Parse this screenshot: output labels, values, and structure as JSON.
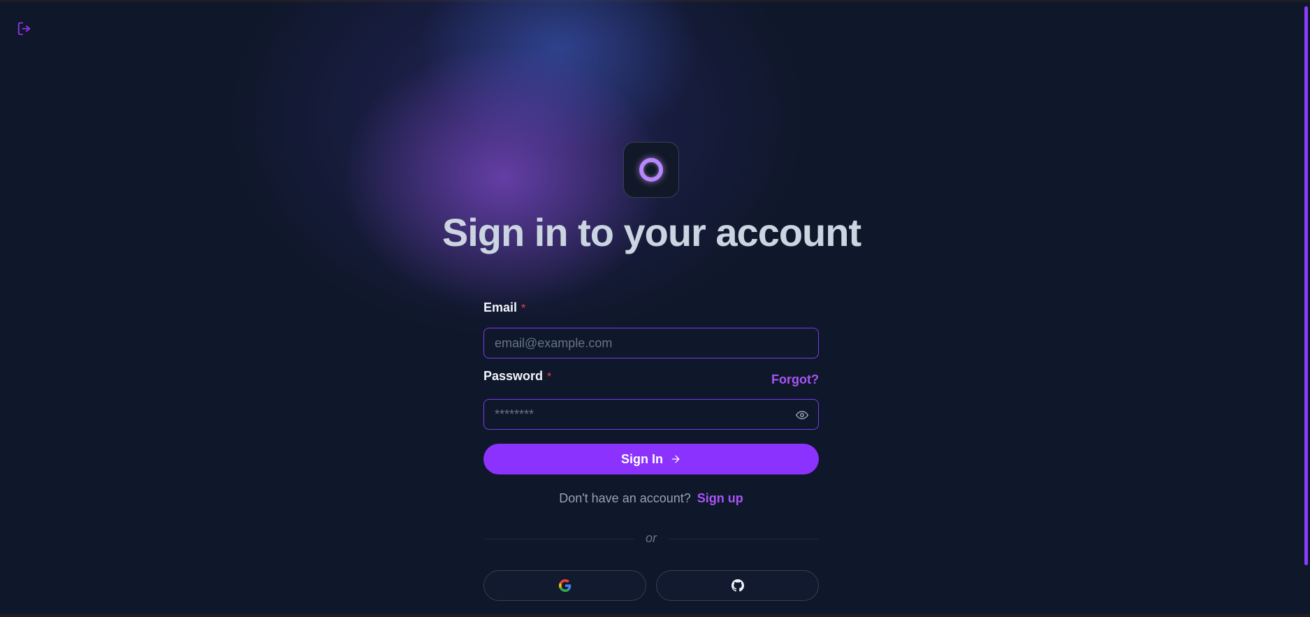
{
  "page": {
    "title": "Sign in to your account"
  },
  "form": {
    "email_label": "Email",
    "email_required_mark": "*",
    "email_placeholder": "email@example.com",
    "password_label": "Password",
    "password_required_mark": "*",
    "password_placeholder": "********",
    "forgot_label": "Forgot?",
    "signin_label": "Sign In",
    "signup_prompt": "Don't have an account?",
    "signup_link": "Sign up",
    "divider_label": "or"
  },
  "icons": {
    "exit": "log-out-icon",
    "logo": "ring-logo-icon",
    "password_toggle": "eye-icon",
    "signin_arrow": "arrow-right-icon",
    "google": "google-icon",
    "github": "github-icon"
  },
  "colors": {
    "background": "#0f172a",
    "accent": "#8b32ff",
    "link": "#a855f7",
    "required": "#ef4444",
    "input_border": "#7c3aed"
  }
}
